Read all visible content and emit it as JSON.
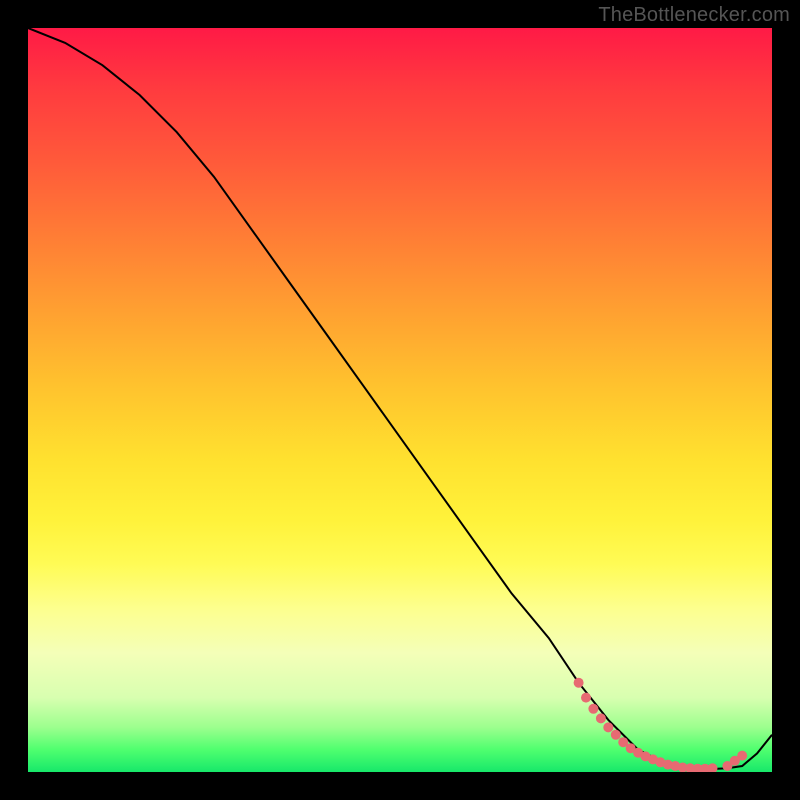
{
  "watermark": "TheBottlenecker.com",
  "chart_data": {
    "type": "line",
    "title": "",
    "xlabel": "",
    "ylabel": "",
    "xlim": [
      0,
      100
    ],
    "ylim": [
      0,
      100
    ],
    "series": [
      {
        "name": "curve",
        "x": [
          0,
          5,
          10,
          15,
          20,
          25,
          30,
          35,
          40,
          45,
          50,
          55,
          60,
          65,
          70,
          74,
          78,
          82,
          84,
          86,
          88,
          90,
          92,
          94,
          96,
          98,
          100
        ],
        "y": [
          100,
          98,
          95,
          91,
          86,
          80,
          73,
          66,
          59,
          52,
          45,
          38,
          31,
          24,
          18,
          12,
          7,
          3,
          2,
          1,
          0.5,
          0.4,
          0.4,
          0.5,
          0.8,
          2.5,
          5
        ]
      }
    ],
    "markers": {
      "name": "highlight-points",
      "color": "#e76a72",
      "x": [
        74,
        75,
        76,
        77,
        78,
        79,
        80,
        81,
        82,
        83,
        84,
        85,
        86,
        87,
        88,
        89,
        90,
        91,
        92,
        94,
        95,
        96
      ],
      "y": [
        12,
        10,
        8.5,
        7.2,
        6.0,
        5.0,
        4.0,
        3.2,
        2.6,
        2.1,
        1.7,
        1.3,
        1.0,
        0.8,
        0.6,
        0.5,
        0.45,
        0.45,
        0.5,
        0.8,
        1.5,
        2.2
      ]
    }
  }
}
